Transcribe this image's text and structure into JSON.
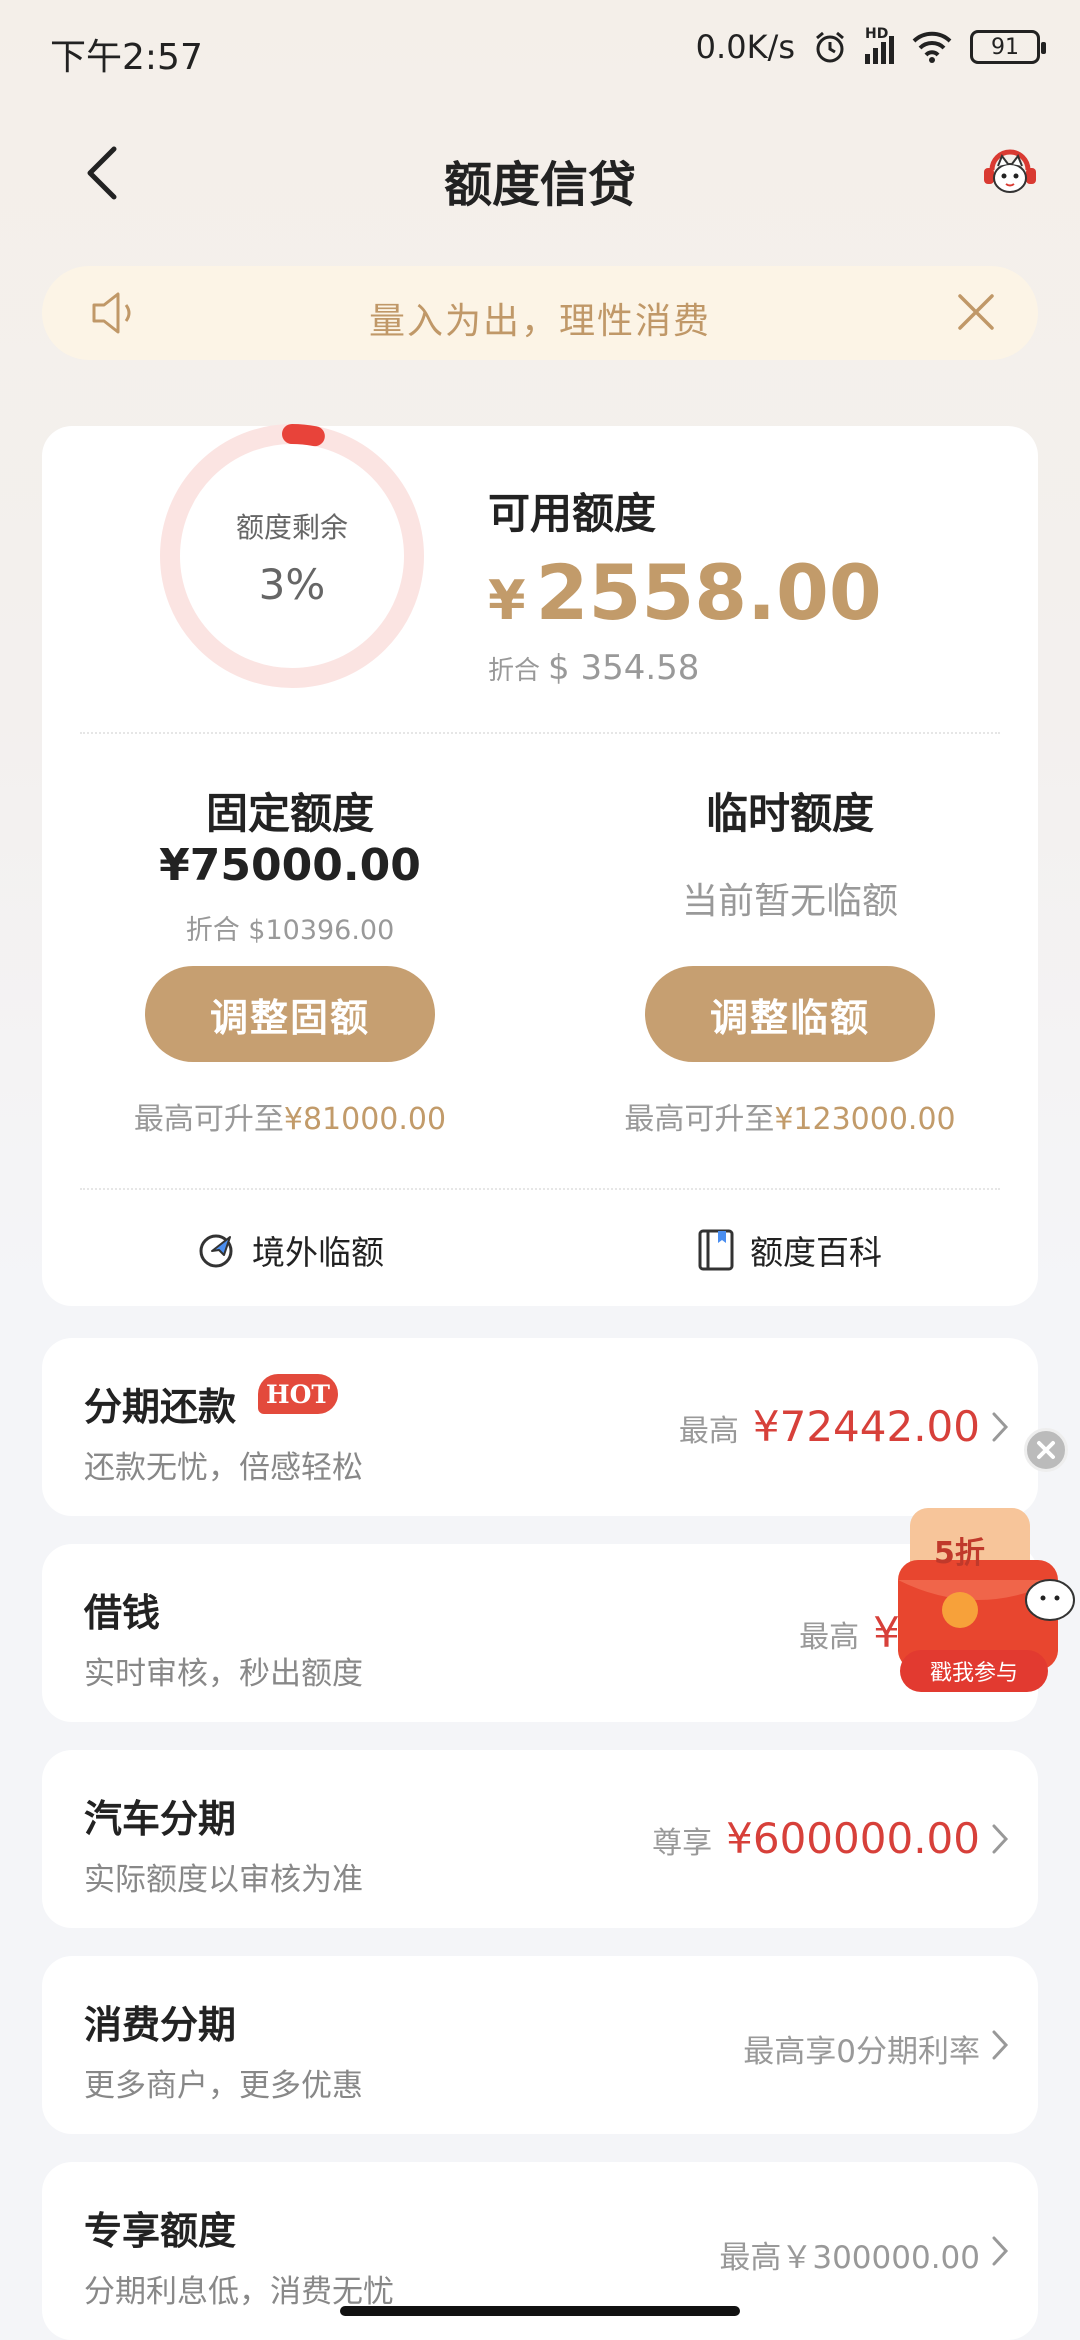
{
  "status_bar": {
    "time": "下午2:57",
    "net_speed": "0.0K/s",
    "network": "HD",
    "battery": "91"
  },
  "header": {
    "title": "额度信贷"
  },
  "notice": {
    "text": "量入为出，理性消费"
  },
  "credit": {
    "ring_label": "额度剩余",
    "ring_percent": "3%",
    "remaining_fraction": 0.03,
    "available_label": "可用额度",
    "currency": "¥",
    "available_amount": "2558.00",
    "converted_prefix": "折合",
    "converted_amount": "$ 354.58",
    "accent_color": "#c29b6a",
    "ring_color": "#e8433a"
  },
  "fixed": {
    "title": "固定额度",
    "amount": "¥75000.00",
    "converted": "折合 $10396.00",
    "button": "调整固额",
    "max_prefix": "最高可升至",
    "max_value": "¥81000.00"
  },
  "temporary": {
    "title": "临时额度",
    "status": "当前暂无临额",
    "button": "调整临额",
    "max_prefix": "最高可升至",
    "max_value": "¥123000.00"
  },
  "links": {
    "overseas": "境外临额",
    "encyclopedia": "额度百科"
  },
  "products": [
    {
      "title": "分期还款",
      "badge": "HOT",
      "subtitle": "还款无忧，倍感轻松",
      "prefix": "最高",
      "value": "¥72442.00"
    },
    {
      "title": "借钱",
      "subtitle": "实时审核，秒出额度",
      "prefix": "最高",
      "value": "¥255"
    },
    {
      "title": "汽车分期",
      "subtitle": "实际额度以审核为准",
      "prefix": "尊享",
      "value": "¥600000.00"
    },
    {
      "title": "消费分期",
      "subtitle": "更多商户，更多优惠",
      "text": "最高享0分期利率"
    },
    {
      "title": "专享额度",
      "subtitle": "分期利息低，消费无忧",
      "text": "最高￥300000.00"
    }
  ],
  "promo": {
    "discount": "5折",
    "label": "戳我参与"
  }
}
